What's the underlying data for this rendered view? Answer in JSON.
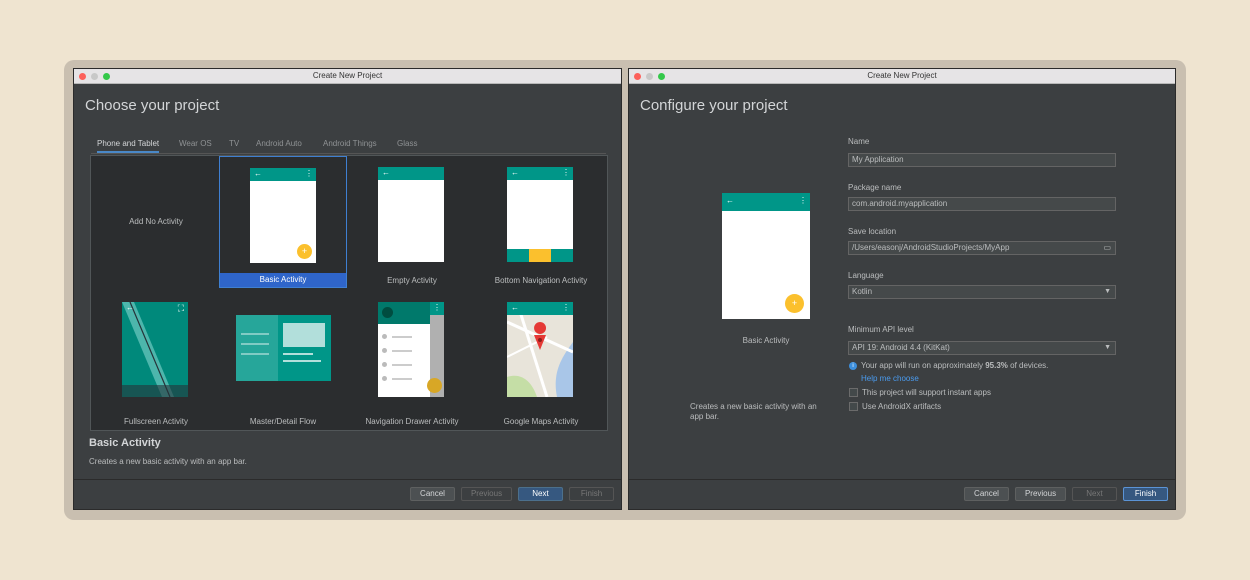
{
  "left_window": {
    "title": "Create New Project",
    "heading": "Choose your project",
    "tabs": [
      "Phone and Tablet",
      "Wear OS",
      "TV",
      "Android Auto",
      "Android Things",
      "Glass"
    ],
    "activities": [
      "Add No Activity",
      "Basic Activity",
      "Empty Activity",
      "Bottom Navigation Activity",
      "Fullscreen Activity",
      "Master/Detail Flow",
      "Navigation Drawer Activity",
      "Google Maps Activity"
    ],
    "selected_title": "Basic Activity",
    "selected_desc": "Creates a new basic activity with an app bar.",
    "buttons": {
      "cancel": "Cancel",
      "previous": "Previous",
      "next": "Next",
      "finish": "Finish"
    }
  },
  "right_window": {
    "title": "Create New Project",
    "heading": "Configure your project",
    "preview_label": "Basic Activity",
    "preview_desc": "Creates a new basic activity with an app bar.",
    "form": {
      "name_label": "Name",
      "name_value": "My Application",
      "package_label": "Package name",
      "package_value": "com.android.myapplication",
      "location_label": "Save location",
      "location_value": "/Users/easonj/AndroidStudioProjects/MyApp",
      "language_label": "Language",
      "language_value": "Kotlin",
      "min_api_label": "Minimum API level",
      "min_api_value": "API 19: Android 4.4 (KitKat)",
      "info_prefix": "Your app will run on approximately ",
      "info_percent": "95.3%",
      "info_suffix": " of devices.",
      "help_link": "Help me choose",
      "instant_apps": "This project will support instant apps",
      "androidx": "Use AndroidX artifacts"
    },
    "buttons": {
      "cancel": "Cancel",
      "previous": "Previous",
      "next": "Next",
      "finish": "Finish"
    }
  },
  "colors": {
    "teal": "#009688",
    "fab": "#fbc02d",
    "selection": "#2f65ca",
    "link": "#4a9bef"
  }
}
